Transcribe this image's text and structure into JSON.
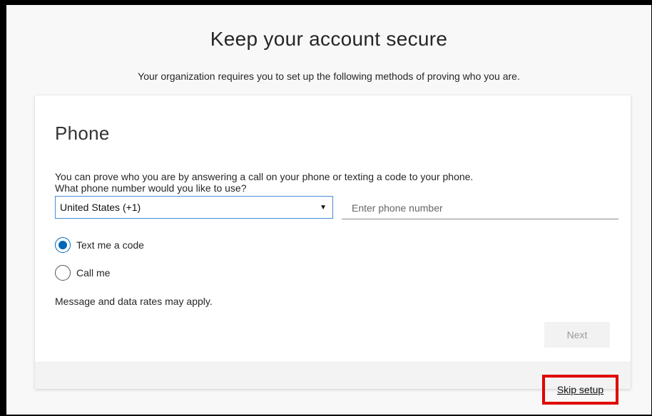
{
  "page": {
    "title": "Keep your account secure",
    "subtitle": "Your organization requires you to set up the following methods of proving who you are."
  },
  "phone_section": {
    "title": "Phone",
    "description_line1": "You can prove who you are by answering a call on your phone or texting a code to your phone.",
    "description_line2": "What phone number would you like to use?",
    "country_select": {
      "selected": "United States (+1)"
    },
    "phone_input": {
      "value": "",
      "placeholder": "Enter phone number"
    },
    "options": [
      {
        "label": "Text me a code",
        "selected": true
      },
      {
        "label": "Call me",
        "selected": false
      }
    ],
    "rates_note": "Message and data rates may apply.",
    "next_label": "Next"
  },
  "footer": {
    "skip_label": "Skip setup"
  },
  "colors": {
    "accent": "#0067b8",
    "highlight": "#e00000",
    "select_border": "#4a8bd6"
  }
}
